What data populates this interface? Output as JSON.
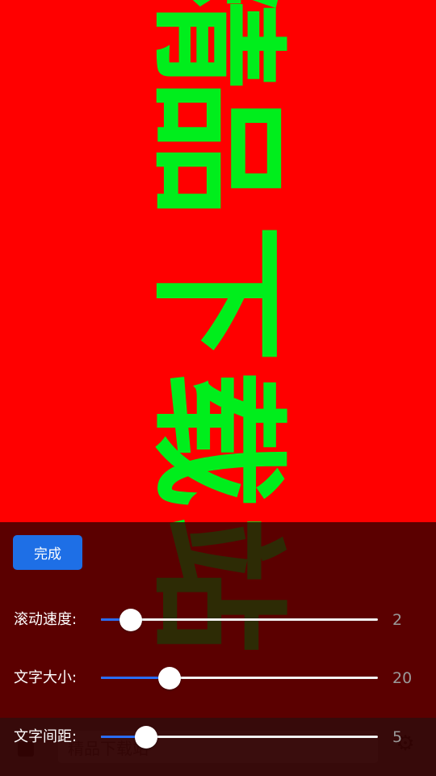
{
  "marquee": {
    "chars": [
      "精",
      "品",
      "下",
      "载",
      "站"
    ],
    "text_color": "#00ee1c",
    "background_color": "#ff0000"
  },
  "input_bar": {
    "text_value": "精品下载站",
    "left_icon": "folder-icon",
    "right_icon": "gear-icon"
  },
  "settings": {
    "done_label": "完成",
    "accent_color": "#1e6fe6",
    "rows": [
      {
        "label": "滚动速度:",
        "value": "2",
        "fraction": 0.108
      },
      {
        "label": "文字大小:",
        "value": "20",
        "fraction": 0.248
      },
      {
        "label": "文字间距:",
        "value": "5",
        "fraction": 0.163
      }
    ]
  }
}
